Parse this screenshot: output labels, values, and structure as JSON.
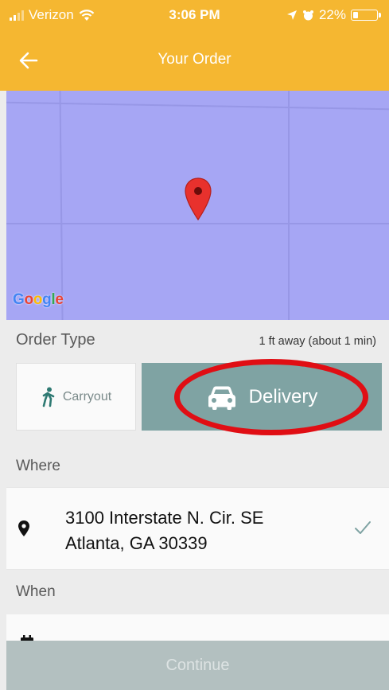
{
  "status_bar": {
    "carrier": "Verizon",
    "time": "3:06 PM",
    "battery_percent": "22%",
    "battery_level": 0.22,
    "icons": [
      "signal-bars-icon",
      "wifi-icon",
      "location-arrow-icon",
      "alarm-icon",
      "battery-icon"
    ]
  },
  "header": {
    "title": "Your Order",
    "back_icon": "arrow-left-icon"
  },
  "map": {
    "attribution": "Google",
    "marker_icon": "map-pin-icon"
  },
  "order_type": {
    "label": "Order Type",
    "distance": "1 ft away (about 1 min)",
    "options": [
      {
        "label": "Carryout",
        "icon": "walking-person-icon",
        "selected": false
      },
      {
        "label": "Delivery",
        "icon": "car-icon",
        "selected": true
      }
    ],
    "highlight_color": "#e00e14"
  },
  "where": {
    "label": "Where",
    "address_line1": "3100 Interstate N. Cir. SE",
    "address_line2": "Atlanta, GA 30339",
    "icon": "location-pin-icon",
    "status_icon": "checkmark-icon"
  },
  "when": {
    "label": "When",
    "icon": "calendar-icon"
  },
  "footer": {
    "continue_label": "Continue"
  },
  "colors": {
    "header": "#f5b731",
    "selected_option": "#7fa3a3",
    "continue_disabled": "#b3c0c0",
    "map": "#a6a6f4"
  }
}
